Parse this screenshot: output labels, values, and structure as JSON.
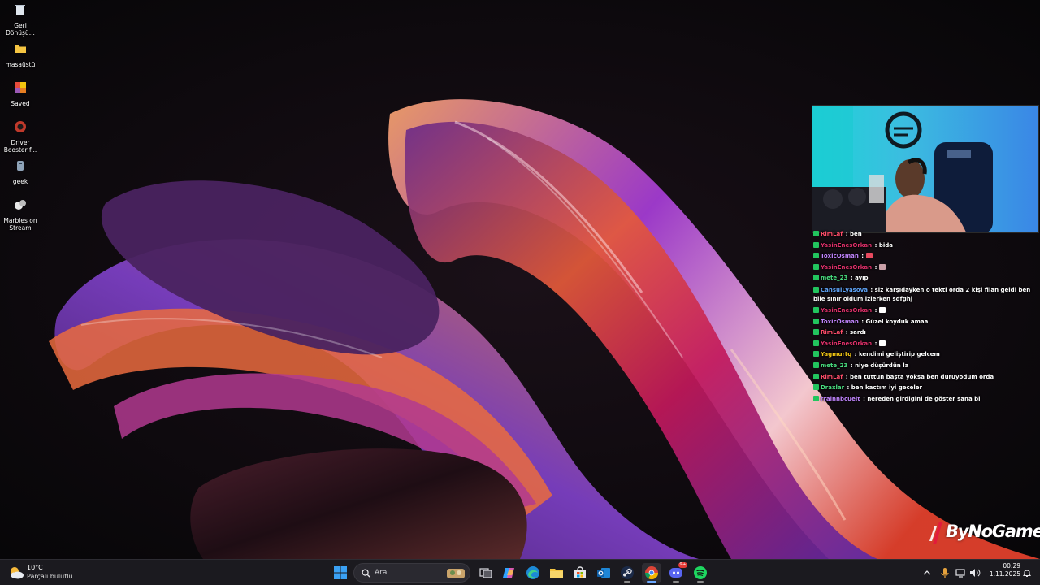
{
  "desktop": {
    "icons": [
      {
        "name": "recycle-bin",
        "label_line1": "Geri",
        "label_line2": "Dönüşü..."
      },
      {
        "name": "folder",
        "label_line1": "masaüstü",
        "label_line2": ""
      },
      {
        "name": "saved-app",
        "label_line1": "Saved",
        "label_line2": ""
      },
      {
        "name": "driver-booster",
        "label_line1": "Driver",
        "label_line2": "Booster f..."
      },
      {
        "name": "geek",
        "label_line1": "geek",
        "label_line2": ""
      },
      {
        "name": "marbles-on-stream",
        "label_line1": "Marbles on",
        "label_line2": "Stream"
      }
    ]
  },
  "chat": {
    "messages": [
      {
        "user": "RimLaf",
        "user_color": "#ff4d6a",
        "text": "ben",
        "badge": "#22c55e"
      },
      {
        "user": "YasinEnesOrkan",
        "user_color": "#e0306a",
        "text": "bida",
        "badge": "#22c55e"
      },
      {
        "user": "ToxicOsman",
        "user_color": "#c084fc",
        "text": "",
        "badge": "#22c55e",
        "emote": "#e84a5f"
      },
      {
        "user": "YasinEnesOrkan",
        "user_color": "#e0306a",
        "text": "",
        "badge": "#22c55e",
        "emote": "#c9a0a8"
      },
      {
        "user": "mete_23",
        "user_color": "#4ade80",
        "text": "ayıp",
        "badge": "#22c55e"
      },
      {
        "user": "CansulLyasova",
        "user_color": "#60a5fa",
        "text": "siz karşıdayken o tekti orda 2 kişi filan geldi ben bile sınır oldum izlerken sdfghj",
        "badge": "#22c55e"
      },
      {
        "user": "YasinEnesOrkan",
        "user_color": "#e0306a",
        "text": "",
        "badge": "#22c55e",
        "emote": "#ffffff"
      },
      {
        "user": "ToxicOsman",
        "user_color": "#c084fc",
        "text": "Güzel koyduk amaa",
        "badge": "#22c55e"
      },
      {
        "user": "RimLaf",
        "user_color": "#ff4d6a",
        "text": "sardı",
        "badge": "#22c55e"
      },
      {
        "user": "YasinEnesOrkan",
        "user_color": "#e0306a",
        "text": "",
        "badge": "#22c55e",
        "emote": "#ffffff"
      },
      {
        "user": "Yagmurtq",
        "user_color": "#facc15",
        "text": "kendimi geliştirip gelcem",
        "badge": "#22c55e"
      },
      {
        "user": "mete_23",
        "user_color": "#4ade80",
        "text": "niye düşürdün la",
        "badge": "#22c55e"
      },
      {
        "user": "RimLaf",
        "user_color": "#ff4d6a",
        "text": "ben tuttun başta yoksa ben duruyodum orda",
        "badge": "#22c55e"
      },
      {
        "user": "Draxlar",
        "user_color": "#4ade80",
        "text": "ben kactım iyi geceler",
        "badge": "#22c55e"
      },
      {
        "user": "rrainnbcuelt",
        "user_color": "#c084fc",
        "text": "nereden girdigini de göster sana bi",
        "badge": "#22c55e"
      }
    ]
  },
  "watermark": {
    "text": "ByNoGame"
  },
  "taskbar": {
    "weather": {
      "temp": "10°C",
      "condition": "Parçalı bulutlu",
      "icon": "partly-cloudy-icon"
    },
    "search": {
      "placeholder": "Ara"
    },
    "apps": [
      "start",
      "search",
      "task-view",
      "copilot",
      "edge",
      "file-explorer",
      "store",
      "outlook",
      "steam",
      "chrome",
      "discord",
      "spotify"
    ],
    "discord_badge": "9+",
    "clock": {
      "time": "00:29",
      "date": "1.11.2025"
    }
  }
}
